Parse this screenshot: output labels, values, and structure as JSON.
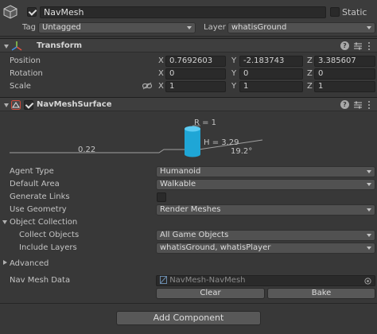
{
  "gameobject": {
    "name": "NavMesh",
    "active": true,
    "static_label": "Static",
    "static": false,
    "tag_label": "Tag",
    "tag_value": "Untagged",
    "layer_label": "Layer",
    "layer_value": "whatisGround"
  },
  "transform": {
    "title": "Transform",
    "position_label": "Position",
    "rotation_label": "Rotation",
    "scale_label": "Scale",
    "axis_x": "X",
    "axis_y": "Y",
    "axis_z": "Z",
    "position": {
      "x": "0.7692603",
      "y": "-2.183743",
      "z": "3.385607"
    },
    "rotation": {
      "x": "0",
      "y": "0",
      "z": "0"
    },
    "scale": {
      "x": "1",
      "y": "1",
      "z": "1"
    }
  },
  "navmesh_surface": {
    "title": "NavMeshSurface",
    "enabled": true,
    "preview": {
      "radius_label": "R = 1",
      "height_label": "H = 3.29",
      "step_label": "0.22",
      "slope_label": "19.2°"
    },
    "agent_type_label": "Agent Type",
    "agent_type_value": "Humanoid",
    "default_area_label": "Default Area",
    "default_area_value": "Walkable",
    "generate_links_label": "Generate Links",
    "generate_links": false,
    "use_geometry_label": "Use Geometry",
    "use_geometry_value": "Render Meshes",
    "object_collection_label": "Object Collection",
    "collect_objects_label": "Collect Objects",
    "collect_objects_value": "All Game Objects",
    "include_layers_label": "Include Layers",
    "include_layers_value": "whatisGround, whatisPlayer",
    "advanced_label": "Advanced",
    "nav_mesh_data_label": "Nav Mesh Data",
    "nav_mesh_data_value": "NavMesh-NavMesh",
    "clear_label": "Clear",
    "bake_label": "Bake"
  },
  "add_component_label": "Add Component",
  "colors": {
    "background": "#383838",
    "field": "#2a2a2a",
    "dropdown": "#515151",
    "agent_cylinder": "#1fa6d6"
  },
  "icons": {
    "gameobject": "cube-icon",
    "transform": "transform-axes-icon",
    "navmesh_surface": "navmesh-surface-icon",
    "help": "help-icon",
    "presets": "presets-icon",
    "menu": "kebab-menu-icon",
    "constrain": "link-icon",
    "object_picker": "object-picker-icon"
  }
}
